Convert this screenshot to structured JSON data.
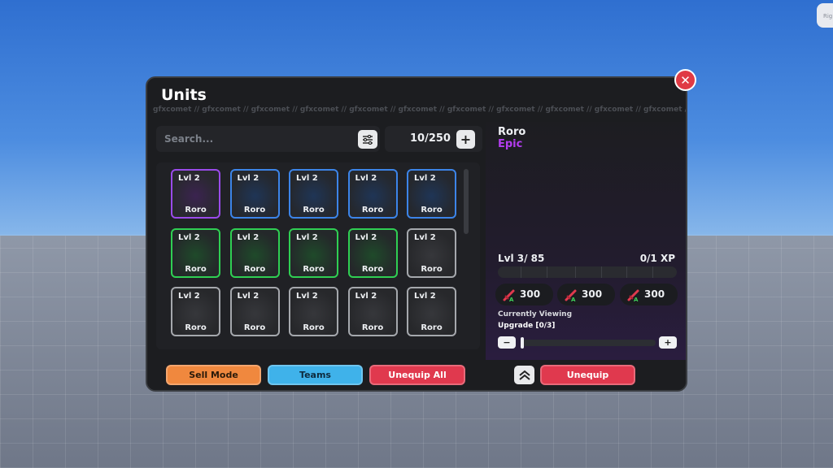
{
  "corner": {
    "label": "Rig"
  },
  "window": {
    "title": "Units",
    "watermark": "gfxcomet // gfxcomet // gfxcomet // gfxcomet // gfxcomet // gfxcomet // gfxcomet // gfxcomet // gfxcomet // gfxcomet // gfxcomet //",
    "close_label": "✕"
  },
  "search": {
    "placeholder": "Search..."
  },
  "inventory": {
    "count": "10/250",
    "plus_label": "+"
  },
  "units": [
    {
      "level": "Lvl 2",
      "name": "Roro",
      "rarity": "epic"
    },
    {
      "level": "Lvl 2",
      "name": "Roro",
      "rarity": "rare"
    },
    {
      "level": "Lvl 2",
      "name": "Roro",
      "rarity": "rare"
    },
    {
      "level": "Lvl 2",
      "name": "Roro",
      "rarity": "rare"
    },
    {
      "level": "Lvl 2",
      "name": "Roro",
      "rarity": "rare"
    },
    {
      "level": "Lvl 2",
      "name": "Roro",
      "rarity": "uncommon"
    },
    {
      "level": "Lvl 2",
      "name": "Roro",
      "rarity": "uncommon"
    },
    {
      "level": "Lvl 2",
      "name": "Roro",
      "rarity": "uncommon"
    },
    {
      "level": "Lvl 2",
      "name": "Roro",
      "rarity": "uncommon"
    },
    {
      "level": "Lvl 2",
      "name": "Roro",
      "rarity": "common"
    },
    {
      "level": "Lvl 2",
      "name": "Roro",
      "rarity": "common"
    },
    {
      "level": "Lvl 2",
      "name": "Roro",
      "rarity": "common"
    },
    {
      "level": "Lvl 2",
      "name": "Roro",
      "rarity": "common"
    },
    {
      "level": "Lvl 2",
      "name": "Roro",
      "rarity": "common"
    },
    {
      "level": "Lvl 2",
      "name": "Roro",
      "rarity": "common"
    }
  ],
  "selected": {
    "name": "Roro",
    "rarity": "Epic",
    "level_text": "Lvl 3/ 85",
    "xp_text": "0/1 XP",
    "xp_progress": 0,
    "stats": [
      {
        "value": "300",
        "icon": "sword-attack-icon"
      },
      {
        "value": "300",
        "icon": "sword-attack-icon"
      },
      {
        "value": "300",
        "icon": "sword-attack-icon"
      }
    ],
    "currently_viewing": "Currently Viewing",
    "upgrade": "Upgrade [0/3]",
    "minus_label": "−",
    "plus_label": "+",
    "slider_value": 0
  },
  "footer": {
    "sell_mode": "Sell Mode",
    "teams": "Teams",
    "unequip_all": "Unequip All",
    "unequip": "Unequip"
  },
  "colors": {
    "epic": "#9a4bea",
    "rare": "#3c84e8",
    "uncommon": "#2fcf53",
    "common": "#a5a8ad",
    "epic_text": "#b33cf0"
  }
}
